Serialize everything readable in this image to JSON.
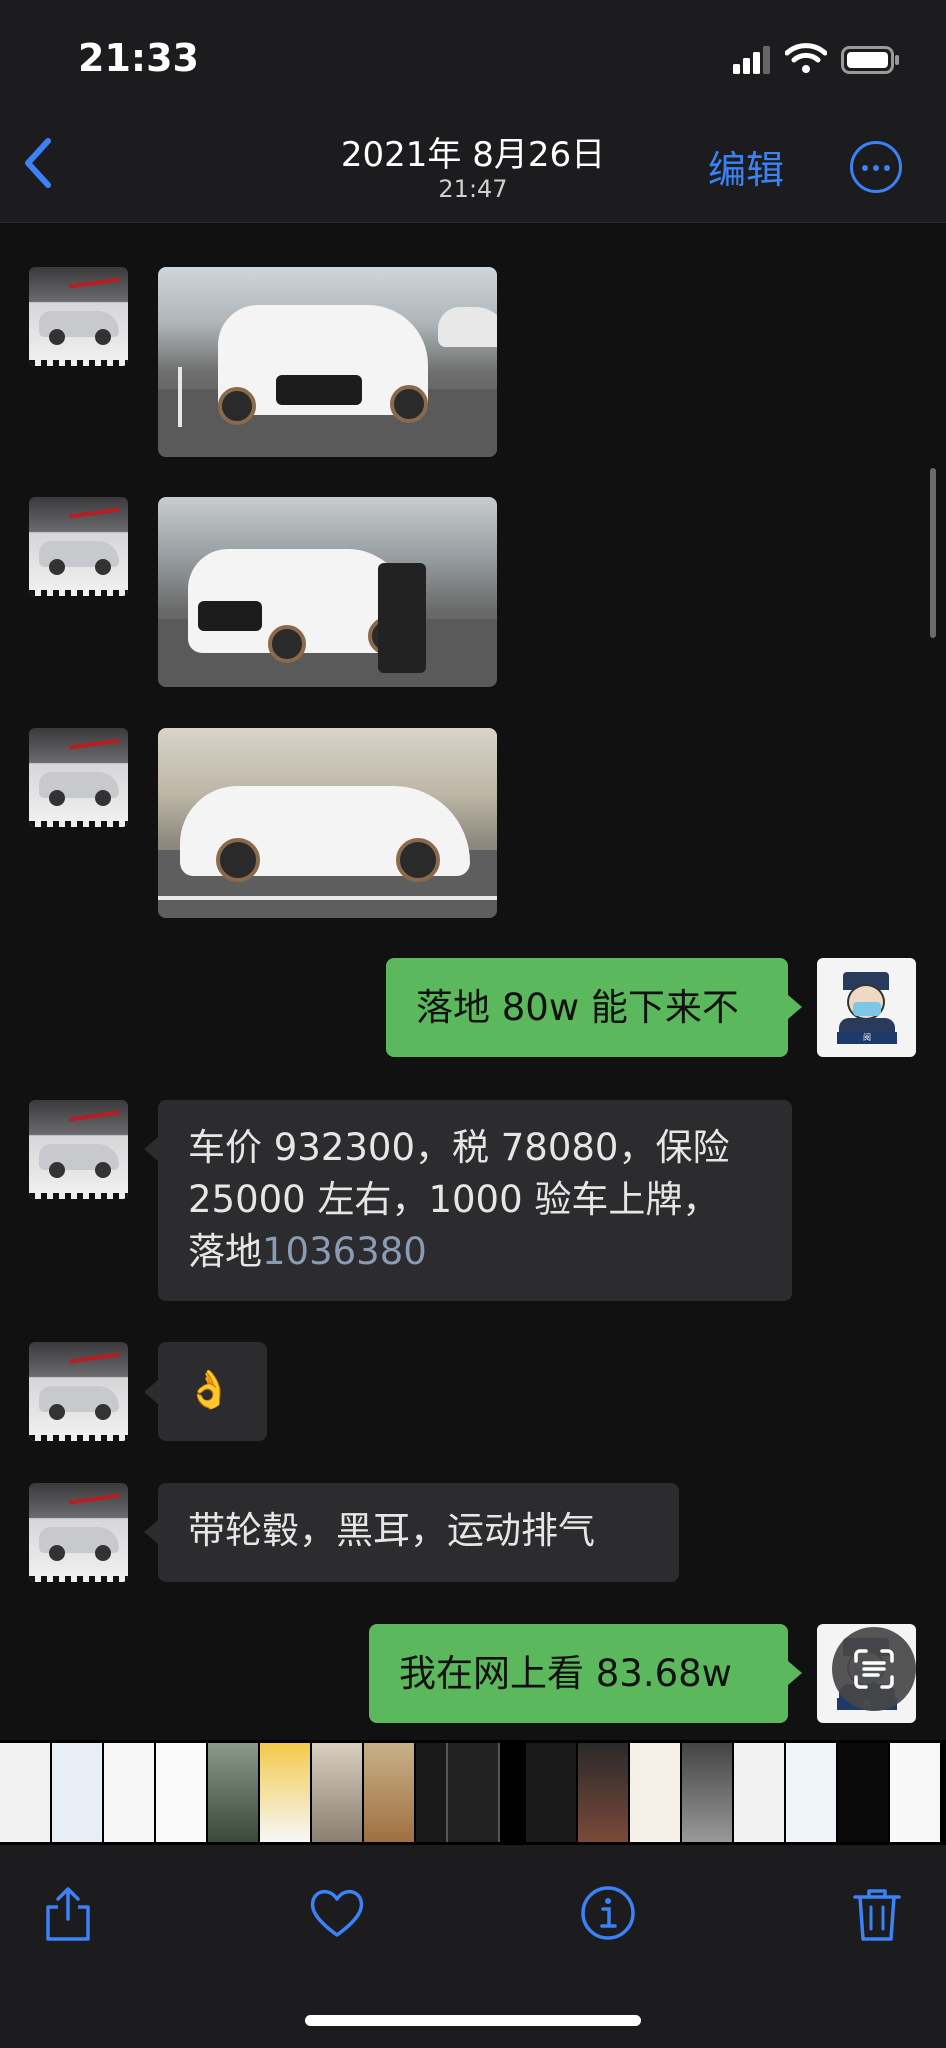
{
  "status_bar": {
    "time": "21:33"
  },
  "header": {
    "date": "2021年 8月26日",
    "time": "21:47",
    "edit_label": "编辑"
  },
  "messages": [
    {
      "side": "left",
      "type": "photo"
    },
    {
      "side": "left",
      "type": "photo"
    },
    {
      "side": "left",
      "type": "photo"
    },
    {
      "side": "right",
      "type": "text",
      "text": "落地 80w 能下来不"
    },
    {
      "side": "left",
      "type": "text",
      "line1": "车价 932300，税 78080，保险",
      "line2": "25000 左右，1000 验车上牌，",
      "line3_prefix": "落地",
      "line3_number": "1036380"
    },
    {
      "side": "left",
      "type": "emoji",
      "text": "👌"
    },
    {
      "side": "left",
      "type": "text",
      "text": "带轮毂，黑耳，运动排气"
    },
    {
      "side": "right",
      "type": "text",
      "text": "我在网上看 83.68w"
    }
  ],
  "colors": {
    "accent": "#3b82f6",
    "sent_bubble": "#5cb85c",
    "received_bubble": "#2c2c2e"
  },
  "icons": [
    "back-icon",
    "more-icon",
    "scan-text-icon",
    "share-icon",
    "heart-icon",
    "info-icon",
    "trash-icon"
  ]
}
